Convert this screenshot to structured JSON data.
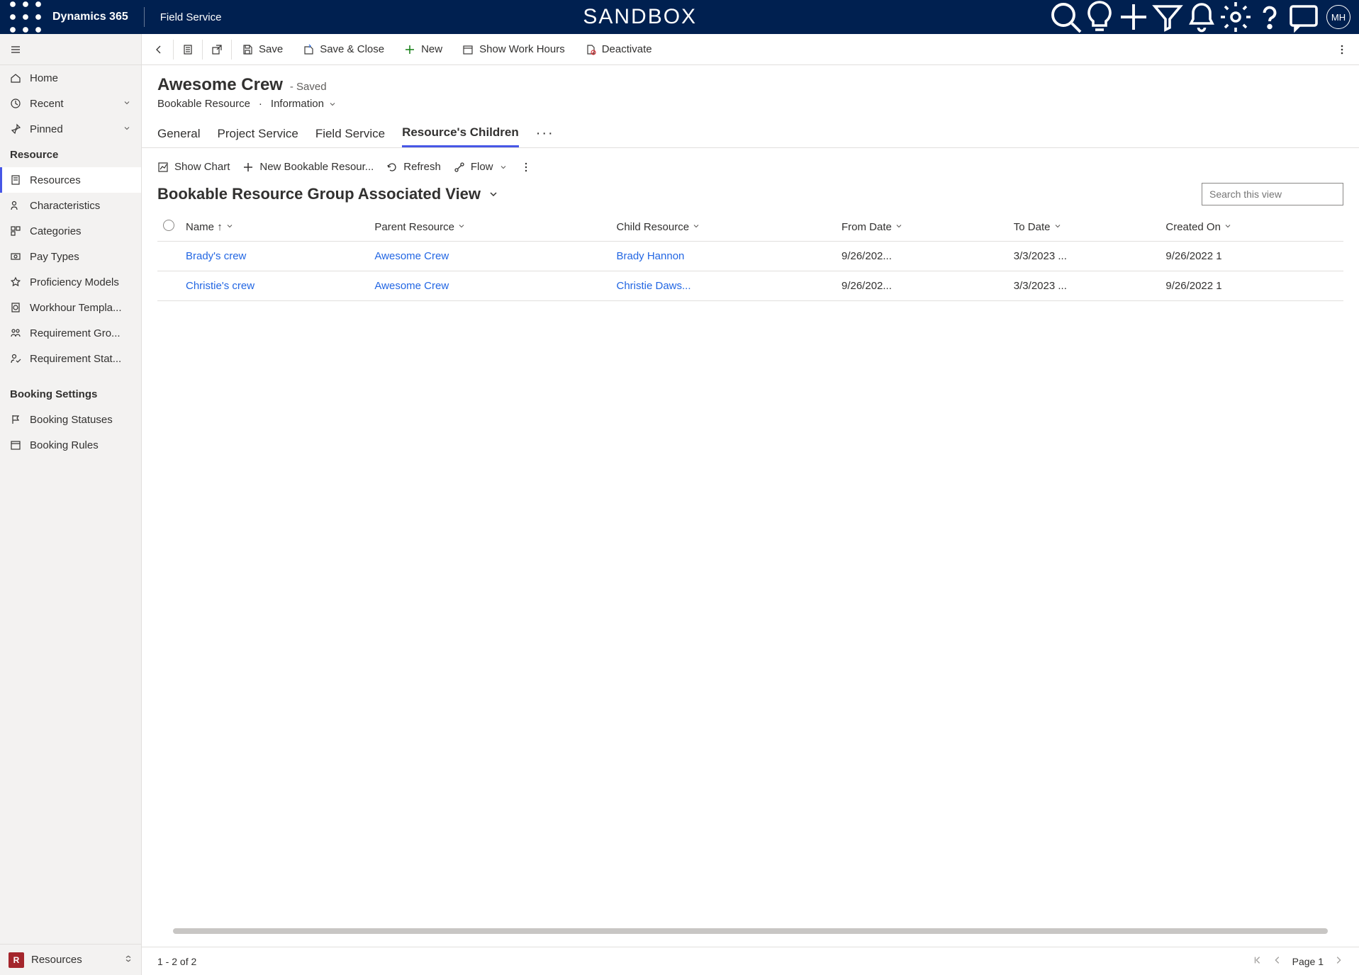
{
  "topnav": {
    "brand": "Dynamics 365",
    "module": "Field Service",
    "env": "SANDBOX",
    "avatar_initials": "MH"
  },
  "sidebar": {
    "home": "Home",
    "recent": "Recent",
    "pinned": "Pinned",
    "group1": "Resource",
    "items1": [
      "Resources",
      "Characteristics",
      "Categories",
      "Pay Types",
      "Proficiency Models",
      "Workhour Templa...",
      "Requirement Gro...",
      "Requirement Stat..."
    ],
    "group2": "Booking Settings",
    "items2": [
      "Booking Statuses",
      "Booking Rules"
    ],
    "area_letter": "R",
    "area": "Resources"
  },
  "commands": {
    "save": "Save",
    "save_close": "Save & Close",
    "new": "New",
    "work_hours": "Show Work Hours",
    "deactivate": "Deactivate"
  },
  "record": {
    "title": "Awesome Crew",
    "saved": "- Saved",
    "entity": "Bookable Resource",
    "form": "Information"
  },
  "tabs": [
    "General",
    "Project Service",
    "Field Service",
    "Resource's Children"
  ],
  "active_tab_index": 3,
  "subgrid": {
    "show_chart": "Show Chart",
    "new": "New Bookable Resour...",
    "refresh": "Refresh",
    "flow": "Flow",
    "view": "Bookable Resource Group Associated View",
    "search_placeholder": "Search this view",
    "columns": [
      "Name",
      "Parent Resource",
      "Child Resource",
      "From Date",
      "To Date",
      "Created On"
    ],
    "sort_col_index": 0,
    "rows": [
      {
        "name": "Brady's crew",
        "parent": "Awesome Crew",
        "child": "Brady Hannon",
        "from": "9/26/202...",
        "to": "3/3/2023 ...",
        "created": "9/26/2022 1"
      },
      {
        "name": "Christie's crew",
        "parent": "Awesome Crew",
        "child": "Christie Daws...",
        "from": "9/26/202...",
        "to": "3/3/2023 ...",
        "created": "9/26/2022 1"
      }
    ]
  },
  "footer": {
    "count": "1 - 2 of 2",
    "page": "Page 1"
  }
}
